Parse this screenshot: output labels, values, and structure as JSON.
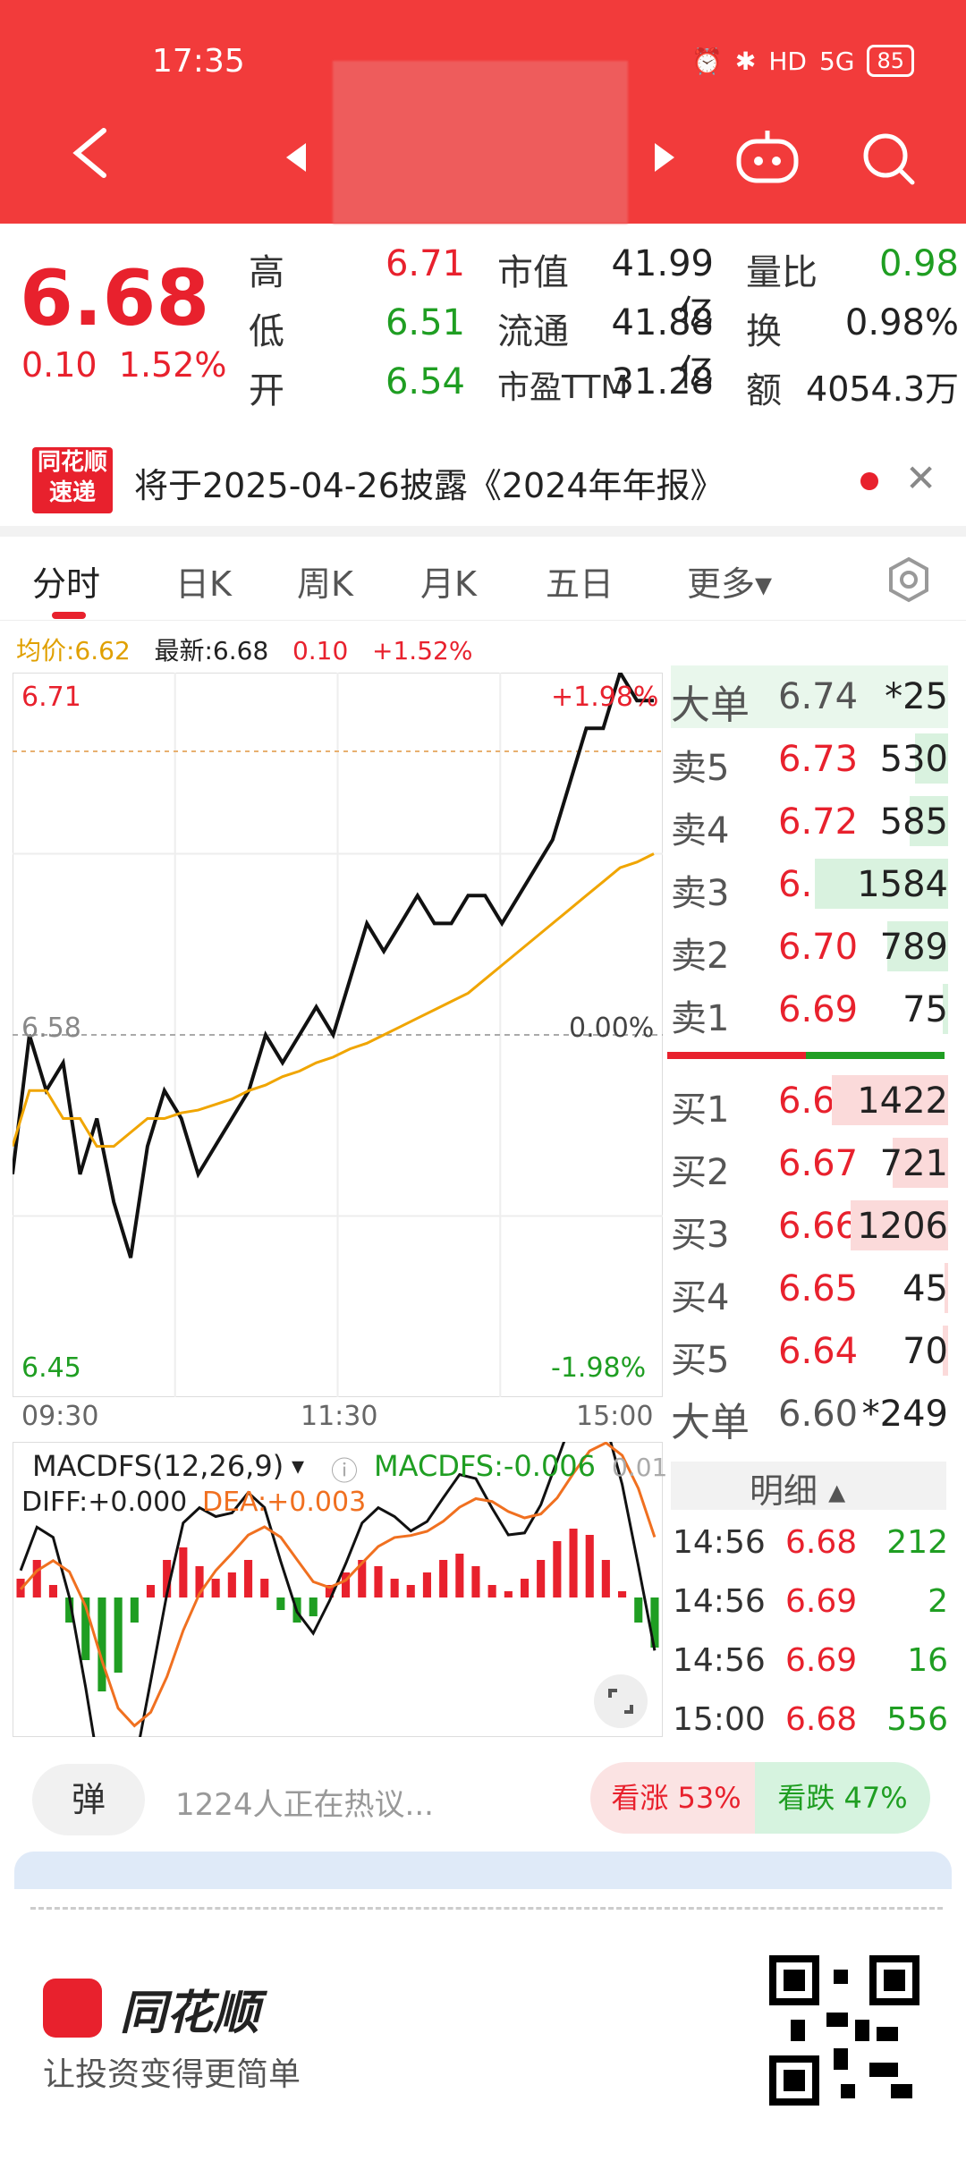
{
  "status": {
    "time": "17:35",
    "battery": "85",
    "network": "5G",
    "hd": "HD"
  },
  "quote": {
    "price": "6.68",
    "change": "0.10",
    "change_pct": "1.52%",
    "rows": [
      {
        "l1": "高",
        "v1": "6.71",
        "l2": "市值",
        "v2": "41.99亿",
        "l3": "量比",
        "v3": "0.98"
      },
      {
        "l1": "低",
        "v1": "6.51",
        "l2": "流通",
        "v2": "41.88亿",
        "l3": "换",
        "v3": "0.98%"
      },
      {
        "l1": "开",
        "v1": "6.54",
        "l2": "市盈TTM",
        "v2": "31.28",
        "l3": "额",
        "v3": "4054.3万"
      }
    ]
  },
  "notice": {
    "logo_top": "同花顺",
    "logo_bottom": "速递",
    "text": "将于2025-04-26披露《2024年年报》"
  },
  "tabs": [
    {
      "label": "分时",
      "active": true
    },
    {
      "label": "日K"
    },
    {
      "label": "周K"
    },
    {
      "label": "月K"
    },
    {
      "label": "五日"
    },
    {
      "label": "更多▾"
    }
  ],
  "legend": {
    "avg": "均价:6.62",
    "latest": "最新:6.68",
    "chg": "0.10",
    "pct": "+1.52%"
  },
  "chart_data": [
    {
      "type": "line",
      "title": "分时",
      "x_ticks": [
        "09:30",
        "11:30",
        "15:00"
      ],
      "y_labels_left": [
        "6.71",
        "6.58",
        "6.45"
      ],
      "y_labels_right": [
        "+1.98%",
        "0.00%",
        "-1.98%"
      ],
      "ylim": [
        6.45,
        6.71
      ],
      "prev_close": 6.58,
      "series": [
        {
          "name": "最新",
          "values": [
            6.53,
            6.58,
            6.56,
            6.57,
            6.53,
            6.55,
            6.52,
            6.5,
            6.54,
            6.56,
            6.55,
            6.53,
            6.54,
            6.55,
            6.56,
            6.58,
            6.57,
            6.58,
            6.59,
            6.58,
            6.6,
            6.62,
            6.61,
            6.62,
            6.63,
            6.62,
            6.62,
            6.63,
            6.63,
            6.62,
            6.63,
            6.64,
            6.65,
            6.67,
            6.69,
            6.69,
            6.71,
            6.7,
            6.7
          ]
        },
        {
          "name": "均价",
          "values": [
            6.54,
            6.56,
            6.56,
            6.55,
            6.55,
            6.54,
            6.54,
            6.545,
            6.55,
            6.55,
            6.552,
            6.553,
            6.555,
            6.557,
            6.56,
            6.562,
            6.565,
            6.567,
            6.57,
            6.572,
            6.575,
            6.577,
            6.58,
            6.583,
            6.586,
            6.589,
            6.592,
            6.595,
            6.6,
            6.605,
            6.61,
            6.615,
            6.62,
            6.625,
            6.63,
            6.635,
            6.64,
            6.642,
            6.645
          ]
        }
      ],
      "avg_line_color": "#f0a500",
      "price_line_color": "#111111"
    },
    {
      "type": "bar",
      "title": "MACDFS(12,26,9)",
      "ylim": [
        -0.02,
        0.02
      ],
      "values": [
        0.003,
        0.006,
        0.002,
        -0.004,
        -0.01,
        -0.015,
        -0.012,
        -0.004,
        0.002,
        0.006,
        0.008,
        0.005,
        0.003,
        0.004,
        0.006,
        0.003,
        -0.002,
        -0.004,
        -0.003,
        0.002,
        0.004,
        0.006,
        0.005,
        0.003,
        0.002,
        0.004,
        0.006,
        0.007,
        0.005,
        0.002,
        0.001,
        0.003,
        0.006,
        0.009,
        0.011,
        0.01,
        0.006,
        0.001,
        -0.004,
        -0.008
      ],
      "series_labels": {
        "diff": "DIFF:+0.000",
        "dea": "DEA:+0.003",
        "macd": "MACDFS:-0.006"
      },
      "right_label": "0.01"
    }
  ],
  "orderbook": {
    "big_top": {
      "label": "大单",
      "price": "6.74",
      "vol": "*25"
    },
    "sells": [
      {
        "label": "卖5",
        "price": "6.73",
        "vol": "530",
        "fill": 0.12
      },
      {
        "label": "卖4",
        "price": "6.72",
        "vol": "585",
        "fill": 0.14
      },
      {
        "label": "卖3",
        "price": "6.71",
        "vol": "1584",
        "fill": 0.48
      },
      {
        "label": "卖2",
        "price": "6.70",
        "vol": "789",
        "fill": 0.22
      },
      {
        "label": "卖1",
        "price": "6.69",
        "vol": "75",
        "fill": 0.02
      }
    ],
    "buys": [
      {
        "label": "买1",
        "price": "6.68",
        "vol": "1422",
        "fill": 0.42
      },
      {
        "label": "买2",
        "price": "6.67",
        "vol": "721",
        "fill": 0.2
      },
      {
        "label": "买3",
        "price": "6.66",
        "vol": "1206",
        "fill": 0.35
      },
      {
        "label": "买4",
        "price": "6.65",
        "vol": "45",
        "fill": 0.01
      },
      {
        "label": "买5",
        "price": "6.64",
        "vol": "70",
        "fill": 0.02
      }
    ],
    "big_bottom": {
      "label": "大单",
      "price": "6.60",
      "vol": "*249"
    },
    "detail_header": "明细 ▴",
    "details": [
      {
        "time": "14:56",
        "price": "6.68",
        "vol": "212"
      },
      {
        "time": "14:56",
        "price": "6.69",
        "vol": "2"
      },
      {
        "time": "14:56",
        "price": "6.69",
        "vol": "16"
      },
      {
        "time": "15:00",
        "price": "6.68",
        "vol": "556"
      }
    ]
  },
  "comment": {
    "danmu": "弹",
    "text": "1224人正在热议...",
    "up": "看涨 53%",
    "down": "看跌 47%"
  },
  "brand": {
    "name": "同花顺",
    "slogan": "让投资变得更简单"
  }
}
